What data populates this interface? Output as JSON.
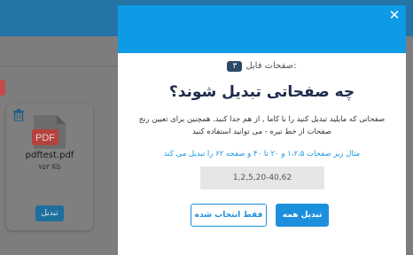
{
  "background": {
    "file": {
      "name": "pdftest.pdf",
      "size": "۷۵۳ Kb",
      "icon_label": "PDF",
      "convert_button": "تبدیل"
    }
  },
  "modal": {
    "pages_label": "صفحات فایل:",
    "pages_count": "۳",
    "title": "چه صفحاتی تبدیل شوند؟",
    "description": "صفحاتی که مایلید تبدیل کنید را با کاما , از هم جدا کنید. همچنین برای تعیین رنج صفحات از خط تیره - می توانید استفاده کنید",
    "example": "مثال زیر صفحات ۱،۲،۵ و ۲۰ تا ۴۰ و صفحه ۶۲ را تبدیل می کند",
    "range_input_value": "1,2,5,20-40,62",
    "convert_all_button": "تبدیل همه",
    "convert_selected_button": "فقط انتخاب شده",
    "close_symbol": "✕"
  },
  "colors": {
    "modal_header": "#0f9ae6",
    "primary": "#1d90dd",
    "title": "#1d2c4a",
    "pdf_red": "#e0443a"
  }
}
